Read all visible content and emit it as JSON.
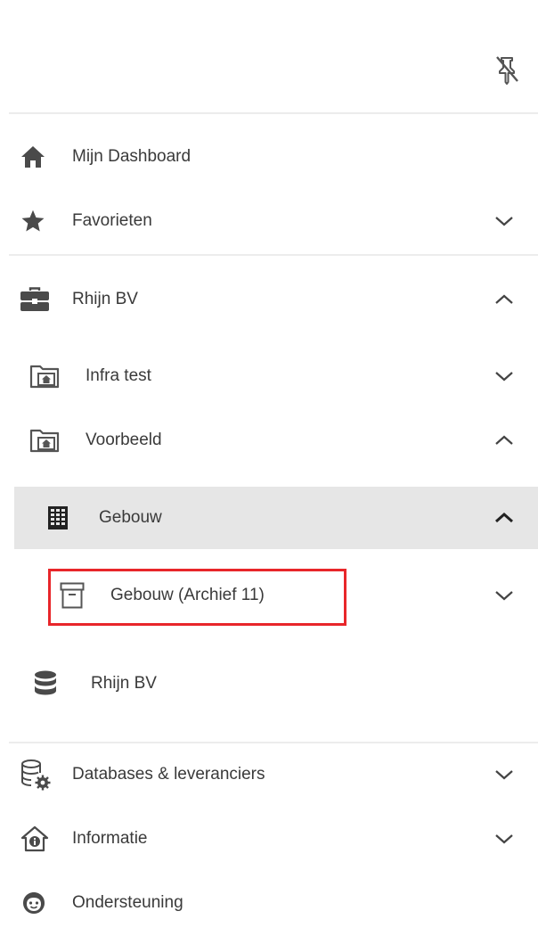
{
  "header": {
    "pin_icon": "pin-off-icon"
  },
  "nav": {
    "dashboard": {
      "label": "Mijn Dashboard",
      "icon": "home-icon"
    },
    "favorites": {
      "label": "Favorieten",
      "icon": "star-icon"
    },
    "org": {
      "label": "Rhijn BV",
      "icon": "briefcase-icon"
    },
    "project_infra": {
      "label": "Infra test",
      "icon": "folder-home-icon"
    },
    "project_voorbeeld": {
      "label": "Voorbeeld",
      "icon": "folder-home-icon"
    },
    "building": {
      "label": "Gebouw",
      "icon": "building-icon"
    },
    "archive": {
      "label": "Gebouw (Archief 11)",
      "icon": "archive-icon"
    },
    "database": {
      "label": "Rhijn BV",
      "icon": "database-icon"
    },
    "databases_suppliers": {
      "label": "Databases & leveranciers",
      "icon": "database-settings-icon"
    },
    "information": {
      "label": "Informatie",
      "icon": "info-house-icon"
    },
    "support": {
      "label": "Ondersteuning",
      "icon": "support-face-icon"
    }
  },
  "colors": {
    "highlight": "#e8262a",
    "selected_bg": "#e6e6e6",
    "text": "#3a3a3a",
    "icon": "#4a4a4a"
  }
}
